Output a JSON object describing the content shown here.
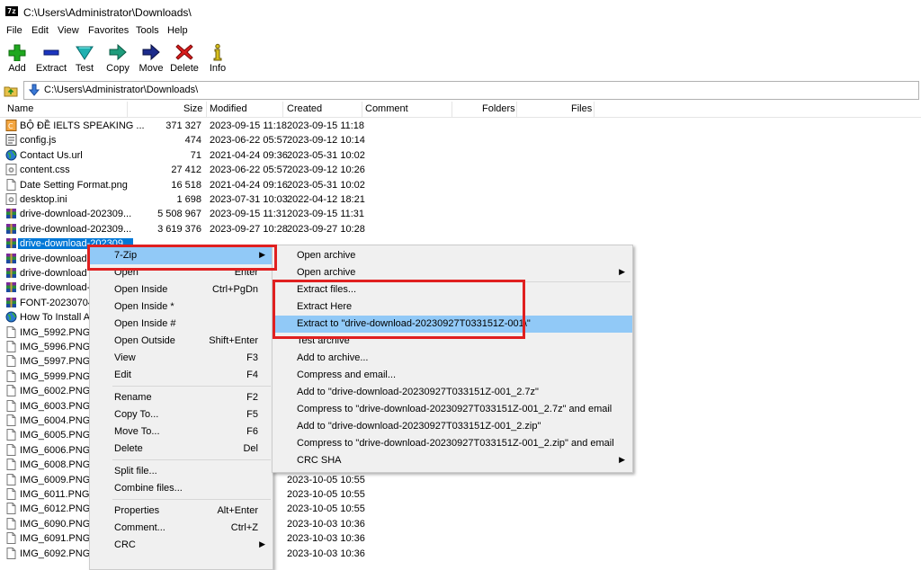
{
  "window": {
    "title": "C:\\Users\\Administrator\\Downloads\\",
    "app_badge": "7z"
  },
  "menu": [
    "File",
    "Edit",
    "View",
    "Favorites",
    "Tools",
    "Help"
  ],
  "toolbar": [
    {
      "label": "Add",
      "icon": "add-icon",
      "color": "#1fa81f"
    },
    {
      "label": "Extract",
      "icon": "extract-icon",
      "color": "#1c35c0"
    },
    {
      "label": "Test",
      "icon": "test-icon",
      "color": "#1fb0b0"
    },
    {
      "label": "Copy",
      "icon": "copy-icon",
      "color": "#1f9c7c"
    },
    {
      "label": "Move",
      "icon": "move-icon",
      "color": "#1c2b8c"
    },
    {
      "label": "Delete",
      "icon": "delete-icon",
      "color": "#d81c1c"
    },
    {
      "label": "Info",
      "icon": "info-icon",
      "color": "#d8c01c"
    }
  ],
  "address": {
    "path": "C:\\Users\\Administrator\\Downloads\\"
  },
  "columns": [
    "Name",
    "Size",
    "Modified",
    "Created",
    "Comment",
    "Folders",
    "Files"
  ],
  "files": [
    {
      "name": "BỘ ĐỀ IELTS SPEAKING ...",
      "size": "371 327",
      "modified": "2023-09-15 11:18",
      "created": "2023-09-15 11:18",
      "icon": "document-icon"
    },
    {
      "name": "config.js",
      "size": "474",
      "modified": "2023-06-22 05:57",
      "created": "2023-09-12 10:14",
      "icon": "script-icon"
    },
    {
      "name": "Contact Us.url",
      "size": "71",
      "modified": "2021-04-24 09:36",
      "created": "2023-05-31 10:02",
      "icon": "globe-icon"
    },
    {
      "name": "content.css",
      "size": "27 412",
      "modified": "2023-06-22 05:57",
      "created": "2023-09-12 10:26",
      "icon": "gear-file-icon"
    },
    {
      "name": "Date Setting Format.png",
      "size": "16 518",
      "modified": "2021-04-24 09:16",
      "created": "2023-05-31 10:02",
      "icon": "file-icon"
    },
    {
      "name": "desktop.ini",
      "size": "1 698",
      "modified": "2023-07-31 10:03",
      "created": "2022-04-12 18:21",
      "icon": "gear-file-icon"
    },
    {
      "name": "drive-download-202309...",
      "size": "5 508 967",
      "modified": "2023-09-15 11:31",
      "created": "2023-09-15 11:31",
      "icon": "archive-icon"
    },
    {
      "name": "drive-download-202309...",
      "size": "3 619 376",
      "modified": "2023-09-27 10:28",
      "created": "2023-09-27 10:28",
      "icon": "archive-icon"
    },
    {
      "name": "drive-download-202309...",
      "size": "",
      "modified": "",
      "created": "",
      "icon": "archive-icon",
      "selected": true
    },
    {
      "name": "drive-download",
      "size": "",
      "modified": "",
      "created": "",
      "icon": "archive-icon"
    },
    {
      "name": "drive-download",
      "size": "",
      "modified": "",
      "created": "",
      "icon": "archive-icon"
    },
    {
      "name": "drive-download-",
      "size": "",
      "modified": "",
      "created": "",
      "icon": "archive-icon"
    },
    {
      "name": "FONT-20230704T",
      "size": "",
      "modified": "",
      "created": "",
      "icon": "archive-icon"
    },
    {
      "name": "How To Install A",
      "size": "",
      "modified": "",
      "created": "",
      "icon": "globe-icon"
    },
    {
      "name": "IMG_5992.PNG",
      "size": "",
      "modified": "",
      "created": "",
      "icon": "file-icon"
    },
    {
      "name": "IMG_5996.PNG",
      "size": "",
      "modified": "",
      "created": "",
      "icon": "file-icon"
    },
    {
      "name": "IMG_5997.PNG",
      "size": "",
      "modified": "",
      "created": "",
      "icon": "file-icon"
    },
    {
      "name": "IMG_5999.PNG",
      "size": "",
      "modified": "",
      "created": "",
      "icon": "file-icon"
    },
    {
      "name": "IMG_6002.PNG",
      "size": "",
      "modified": "",
      "created": "",
      "icon": "file-icon"
    },
    {
      "name": "IMG_6003.PNG",
      "size": "",
      "modified": "",
      "created": "",
      "icon": "file-icon"
    },
    {
      "name": "IMG_6004.PNG",
      "size": "",
      "modified": "",
      "created": "",
      "icon": "file-icon"
    },
    {
      "name": "IMG_6005.PNG",
      "size": "",
      "modified": "",
      "created": "",
      "icon": "file-icon"
    },
    {
      "name": "IMG_6006.PNG",
      "size": "",
      "modified": "",
      "created": "",
      "icon": "file-icon"
    },
    {
      "name": "IMG_6008.PNG",
      "size": "",
      "modified": "",
      "created": "",
      "icon": "file-icon"
    },
    {
      "name": "IMG_6009.PNG",
      "size": "",
      "modified": "",
      "created": "2023-10-05 10:55",
      "icon": "file-icon"
    },
    {
      "name": "IMG_6011.PNG",
      "size": "",
      "modified": "",
      "created": "2023-10-05 10:55",
      "icon": "file-icon"
    },
    {
      "name": "IMG_6012.PNG",
      "size": "",
      "modified": "",
      "created": "2023-10-05 10:55",
      "icon": "file-icon"
    },
    {
      "name": "IMG_6090.PNG",
      "size": "",
      "modified": "",
      "created": "2023-10-03 10:36",
      "icon": "file-icon"
    },
    {
      "name": "IMG_6091.PNG",
      "size": "",
      "modified": "",
      "created": "2023-10-03 10:36",
      "icon": "file-icon"
    },
    {
      "name": "IMG_6092.PNG",
      "size": "",
      "modified": "",
      "created": "2023-10-03 10:36",
      "icon": "file-icon"
    }
  ],
  "context_menu": [
    {
      "label": "7-Zip",
      "shortcut": "",
      "submenu": true,
      "highlight": true
    },
    {
      "label": "Open",
      "shortcut": "Enter"
    },
    {
      "label": "Open Inside",
      "shortcut": "Ctrl+PgDn"
    },
    {
      "label": "Open Inside *",
      "shortcut": ""
    },
    {
      "label": "Open Inside #",
      "shortcut": ""
    },
    {
      "label": "Open Outside",
      "shortcut": "Shift+Enter"
    },
    {
      "label": "View",
      "shortcut": "F3"
    },
    {
      "label": "Edit",
      "shortcut": "F4"
    },
    {
      "sep": true
    },
    {
      "label": "Rename",
      "shortcut": "F2"
    },
    {
      "label": "Copy To...",
      "shortcut": "F5"
    },
    {
      "label": "Move To...",
      "shortcut": "F6"
    },
    {
      "label": "Delete",
      "shortcut": "Del"
    },
    {
      "sep": true
    },
    {
      "label": "Split file...",
      "shortcut": ""
    },
    {
      "label": "Combine files...",
      "shortcut": ""
    },
    {
      "sep": true
    },
    {
      "label": "Properties",
      "shortcut": "Alt+Enter"
    },
    {
      "label": "Comment...",
      "shortcut": "Ctrl+Z"
    },
    {
      "label": "CRC",
      "shortcut": "",
      "submenu": true
    }
  ],
  "submenu": [
    {
      "label": "Open archive",
      "submenu": false
    },
    {
      "label": "Open archive",
      "submenu": true
    },
    {
      "label": "Extract files..."
    },
    {
      "label": "Extract Here"
    },
    {
      "label": "Extract to \"drive-download-20230927T033151Z-001\\\"",
      "highlight": true
    },
    {
      "label": "Test archive"
    },
    {
      "label": "Add to archive..."
    },
    {
      "label": "Compress and email..."
    },
    {
      "label": "Add to \"drive-download-20230927T033151Z-001_2.7z\""
    },
    {
      "label": "Compress to \"drive-download-20230927T033151Z-001_2.7z\" and email"
    },
    {
      "label": "Add to \"drive-download-20230927T033151Z-001_2.zip\""
    },
    {
      "label": "Compress to \"drive-download-20230927T033151Z-001_2.zip\" and email"
    },
    {
      "label": "CRC SHA",
      "submenu": true
    }
  ]
}
